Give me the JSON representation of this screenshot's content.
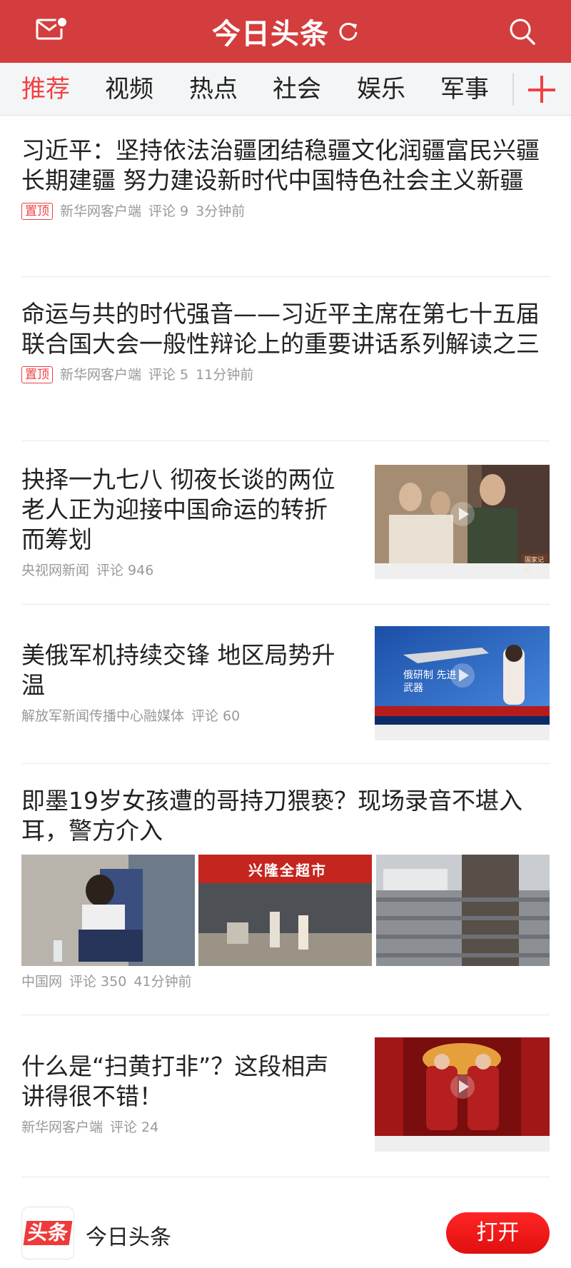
{
  "header": {
    "logo": "今日头条"
  },
  "tabs": [
    {
      "label": "推荐",
      "active": true
    },
    {
      "label": "视频"
    },
    {
      "label": "热点"
    },
    {
      "label": "社会"
    },
    {
      "label": "娱乐"
    },
    {
      "label": "军事"
    }
  ],
  "articles": [
    {
      "title": "习近平：坚持依法治疆团结稳疆文化润疆富民兴疆长期建疆 努力建设新时代中国特色社会主义新疆",
      "pin": "置顶",
      "source": "新华网客户端",
      "comments": "评论 9",
      "time": "3分钟前"
    },
    {
      "title": "命运与共的时代强音——习近平主席在第七十五届联合国大会一般性辩论上的重要讲话系列解读之三",
      "pin": "置顶",
      "source": "新华网客户端",
      "comments": "评论 5",
      "time": "11分钟前"
    },
    {
      "title": "抉择一九七八 彻夜长谈的两位老人正为迎接中国命运的转折而筹划",
      "source": "央视网新闻",
      "comments": "评论 946",
      "thumb_caption": "国家记忆"
    },
    {
      "title": "美俄军机持续交锋 地区局势升温",
      "source": "解放军新闻传播中心融媒体",
      "comments": "评论 60",
      "thumb_caption": "俄研制 先进武器"
    },
    {
      "title": "即墨19岁女孩遭的哥持刀猥亵？现场录音不堪入耳，警方介入",
      "source": "中国网",
      "comments": "评论 350",
      "time": "41分钟前",
      "image_sign": "兴隆全超市"
    },
    {
      "title": "什么是“扫黄打非”？这段相声讲得很不错！",
      "source": "新华网客户端",
      "comments": "评论 24"
    }
  ],
  "bottom": {
    "icon_text": "头条",
    "app_name": "今日头条",
    "open_label": "打开"
  },
  "colors": {
    "brand_red": "#d43d3d",
    "accent_red": "#f04142"
  }
}
